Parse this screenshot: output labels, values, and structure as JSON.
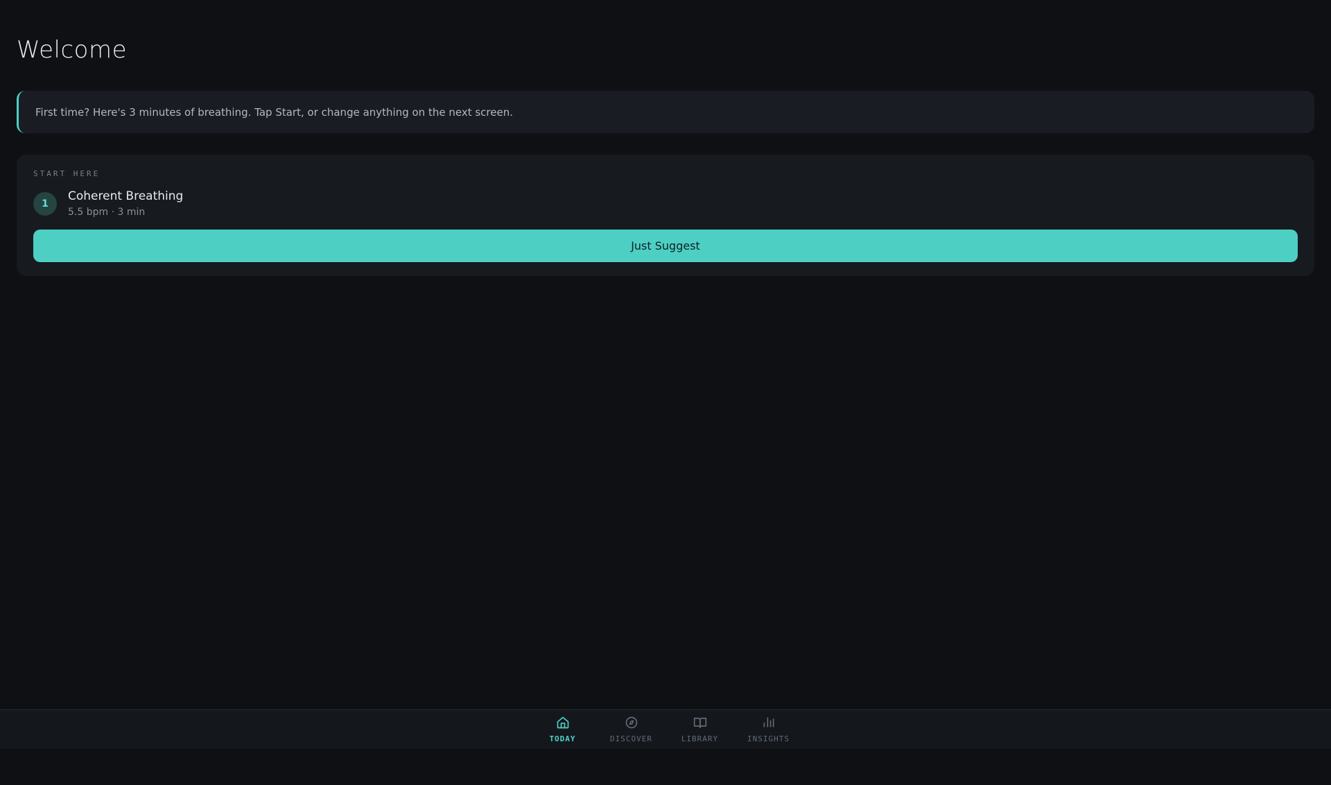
{
  "page": {
    "title": "Welcome"
  },
  "colors": {
    "accent_teal": "#4dcfc4",
    "page_background": "#0e1013",
    "card_background": "#171a1f",
    "banner_background": "#191d23",
    "nav_background": "#14171c",
    "button_text": "#0d2023",
    "badge_background": "#264442",
    "badge_text": "#5fe0d2",
    "inactive_nav": "#646b75"
  },
  "banner": {
    "text": "First time? Here's 3 minutes of breathing. Tap Start, or change anything on the next screen."
  },
  "start_card": {
    "section_label": "START HERE",
    "step_number": "1",
    "title": "Coherent Breathing",
    "subtitle": "5.5 bpm · 3 min",
    "suggest_button_label": "Just Suggest"
  },
  "bottom_nav": {
    "items": [
      {
        "label": "TODAY",
        "icon": "home-icon",
        "active": true
      },
      {
        "label": "DISCOVER",
        "icon": "compass-icon",
        "active": false
      },
      {
        "label": "LIBRARY",
        "icon": "book-open-icon",
        "active": false
      },
      {
        "label": "INSIGHTS",
        "icon": "bar-chart-icon",
        "active": false
      }
    ]
  }
}
